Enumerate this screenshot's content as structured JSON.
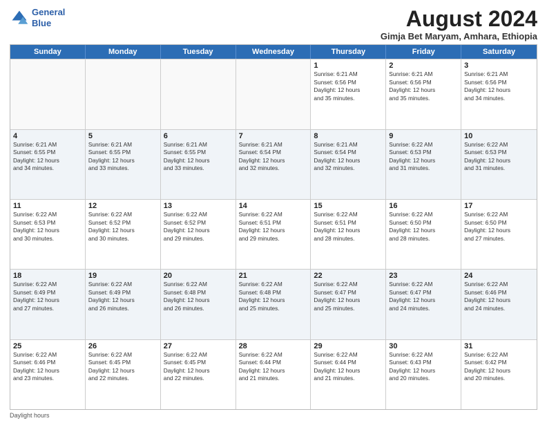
{
  "logo": {
    "line1": "General",
    "line2": "Blue"
  },
  "title": "August 2024",
  "subtitle": "Gimja Bet Maryam, Amhara, Ethiopia",
  "weekdays": [
    "Sunday",
    "Monday",
    "Tuesday",
    "Wednesday",
    "Thursday",
    "Friday",
    "Saturday"
  ],
  "footer": "Daylight hours",
  "weeks": [
    [
      {
        "day": "",
        "text": ""
      },
      {
        "day": "",
        "text": ""
      },
      {
        "day": "",
        "text": ""
      },
      {
        "day": "",
        "text": ""
      },
      {
        "day": "1",
        "text": "Sunrise: 6:21 AM\nSunset: 6:56 PM\nDaylight: 12 hours\nand 35 minutes."
      },
      {
        "day": "2",
        "text": "Sunrise: 6:21 AM\nSunset: 6:56 PM\nDaylight: 12 hours\nand 35 minutes."
      },
      {
        "day": "3",
        "text": "Sunrise: 6:21 AM\nSunset: 6:56 PM\nDaylight: 12 hours\nand 34 minutes."
      }
    ],
    [
      {
        "day": "4",
        "text": "Sunrise: 6:21 AM\nSunset: 6:55 PM\nDaylight: 12 hours\nand 34 minutes."
      },
      {
        "day": "5",
        "text": "Sunrise: 6:21 AM\nSunset: 6:55 PM\nDaylight: 12 hours\nand 33 minutes."
      },
      {
        "day": "6",
        "text": "Sunrise: 6:21 AM\nSunset: 6:55 PM\nDaylight: 12 hours\nand 33 minutes."
      },
      {
        "day": "7",
        "text": "Sunrise: 6:21 AM\nSunset: 6:54 PM\nDaylight: 12 hours\nand 32 minutes."
      },
      {
        "day": "8",
        "text": "Sunrise: 6:21 AM\nSunset: 6:54 PM\nDaylight: 12 hours\nand 32 minutes."
      },
      {
        "day": "9",
        "text": "Sunrise: 6:22 AM\nSunset: 6:53 PM\nDaylight: 12 hours\nand 31 minutes."
      },
      {
        "day": "10",
        "text": "Sunrise: 6:22 AM\nSunset: 6:53 PM\nDaylight: 12 hours\nand 31 minutes."
      }
    ],
    [
      {
        "day": "11",
        "text": "Sunrise: 6:22 AM\nSunset: 6:53 PM\nDaylight: 12 hours\nand 30 minutes."
      },
      {
        "day": "12",
        "text": "Sunrise: 6:22 AM\nSunset: 6:52 PM\nDaylight: 12 hours\nand 30 minutes."
      },
      {
        "day": "13",
        "text": "Sunrise: 6:22 AM\nSunset: 6:52 PM\nDaylight: 12 hours\nand 29 minutes."
      },
      {
        "day": "14",
        "text": "Sunrise: 6:22 AM\nSunset: 6:51 PM\nDaylight: 12 hours\nand 29 minutes."
      },
      {
        "day": "15",
        "text": "Sunrise: 6:22 AM\nSunset: 6:51 PM\nDaylight: 12 hours\nand 28 minutes."
      },
      {
        "day": "16",
        "text": "Sunrise: 6:22 AM\nSunset: 6:50 PM\nDaylight: 12 hours\nand 28 minutes."
      },
      {
        "day": "17",
        "text": "Sunrise: 6:22 AM\nSunset: 6:50 PM\nDaylight: 12 hours\nand 27 minutes."
      }
    ],
    [
      {
        "day": "18",
        "text": "Sunrise: 6:22 AM\nSunset: 6:49 PM\nDaylight: 12 hours\nand 27 minutes."
      },
      {
        "day": "19",
        "text": "Sunrise: 6:22 AM\nSunset: 6:49 PM\nDaylight: 12 hours\nand 26 minutes."
      },
      {
        "day": "20",
        "text": "Sunrise: 6:22 AM\nSunset: 6:48 PM\nDaylight: 12 hours\nand 26 minutes."
      },
      {
        "day": "21",
        "text": "Sunrise: 6:22 AM\nSunset: 6:48 PM\nDaylight: 12 hours\nand 25 minutes."
      },
      {
        "day": "22",
        "text": "Sunrise: 6:22 AM\nSunset: 6:47 PM\nDaylight: 12 hours\nand 25 minutes."
      },
      {
        "day": "23",
        "text": "Sunrise: 6:22 AM\nSunset: 6:47 PM\nDaylight: 12 hours\nand 24 minutes."
      },
      {
        "day": "24",
        "text": "Sunrise: 6:22 AM\nSunset: 6:46 PM\nDaylight: 12 hours\nand 24 minutes."
      }
    ],
    [
      {
        "day": "25",
        "text": "Sunrise: 6:22 AM\nSunset: 6:46 PM\nDaylight: 12 hours\nand 23 minutes."
      },
      {
        "day": "26",
        "text": "Sunrise: 6:22 AM\nSunset: 6:45 PM\nDaylight: 12 hours\nand 22 minutes."
      },
      {
        "day": "27",
        "text": "Sunrise: 6:22 AM\nSunset: 6:45 PM\nDaylight: 12 hours\nand 22 minutes."
      },
      {
        "day": "28",
        "text": "Sunrise: 6:22 AM\nSunset: 6:44 PM\nDaylight: 12 hours\nand 21 minutes."
      },
      {
        "day": "29",
        "text": "Sunrise: 6:22 AM\nSunset: 6:44 PM\nDaylight: 12 hours\nand 21 minutes."
      },
      {
        "day": "30",
        "text": "Sunrise: 6:22 AM\nSunset: 6:43 PM\nDaylight: 12 hours\nand 20 minutes."
      },
      {
        "day": "31",
        "text": "Sunrise: 6:22 AM\nSunset: 6:42 PM\nDaylight: 12 hours\nand 20 minutes."
      }
    ]
  ]
}
